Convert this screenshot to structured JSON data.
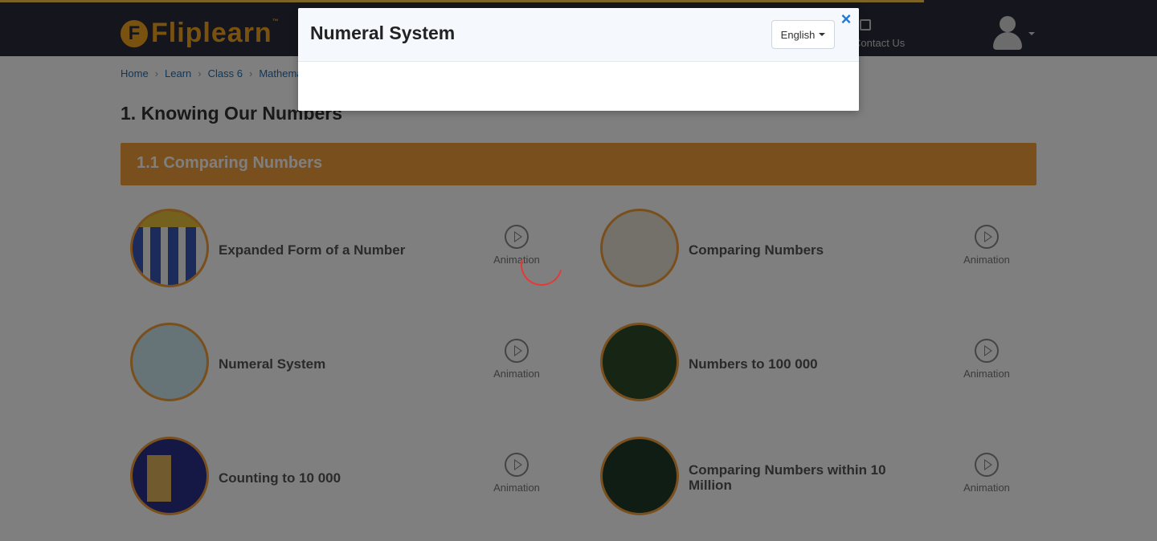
{
  "header": {
    "logo_letter": "F",
    "logo_text": "Fliplearn",
    "logo_tm": "™",
    "contact_label": "Contact Us",
    "accent_color": "#f3a521"
  },
  "breadcrumb": [
    "Home",
    "Learn",
    "Class 6",
    "Mathematics"
  ],
  "chapter_title": "1. Knowing Our Numbers",
  "section_title": "1.1 Comparing Numbers",
  "cards": [
    {
      "title": "Expanded Form of a Number",
      "type": "Animation",
      "icon": "play-icon"
    },
    {
      "title": "Comparing Numbers",
      "type": "Animation",
      "icon": "play-icon"
    },
    {
      "title": "Numeral System",
      "type": "Animation",
      "icon": "play-icon"
    },
    {
      "title": "Numbers to 100 000",
      "type": "Animation",
      "icon": "play-icon"
    },
    {
      "title": "Counting to 10 000",
      "type": "Animation",
      "icon": "play-icon"
    },
    {
      "title": "Comparing Numbers within 10 Million",
      "type": "Animation",
      "icon": "play-icon"
    }
  ],
  "modal": {
    "title": "Numeral System",
    "language": "English",
    "close_glyph": "×"
  },
  "colors": {
    "progress": "#f7c948",
    "section_band": "#f29e3a",
    "spinner": "#e53935",
    "close": "#1e79d8"
  }
}
